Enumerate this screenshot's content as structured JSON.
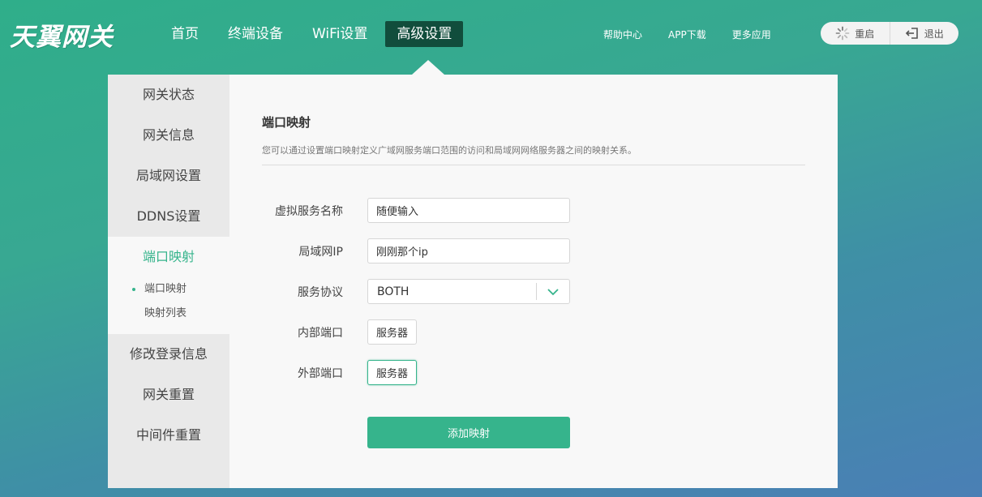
{
  "brand": {
    "logo_text": "天翼网关"
  },
  "nav": {
    "items": [
      {
        "label": "首页"
      },
      {
        "label": "终端设备"
      },
      {
        "label": "WiFi设置"
      },
      {
        "label": "高级设置",
        "active": true
      }
    ]
  },
  "top_links": [
    {
      "label": "帮助中心"
    },
    {
      "label": "APP下载"
    },
    {
      "label": "更多应用"
    }
  ],
  "actions": {
    "restart_label": "重启",
    "logout_label": "退出"
  },
  "sidebar": {
    "items_top": [
      {
        "label": "网关状态"
      },
      {
        "label": "网关信息"
      },
      {
        "label": "局域网设置"
      },
      {
        "label": "DDNS设置"
      }
    ],
    "active_group": {
      "label": "端口映射",
      "sub_items": [
        {
          "label": "端口映射",
          "active": true
        },
        {
          "label": "映射列表"
        }
      ]
    },
    "items_bottom": [
      {
        "label": "修改登录信息"
      },
      {
        "label": "网关重置"
      },
      {
        "label": "中间件重置"
      }
    ]
  },
  "content": {
    "title": "端口映射",
    "description": "您可以通过设置端口映射定义广域网服务端口范围的访问和局域网网络服务器之间的映射关系。",
    "form": {
      "service_name": {
        "label": "虚拟服务名称",
        "value": "随便输入"
      },
      "lan_ip": {
        "label": "局域网IP",
        "value": "刚刚那个ip"
      },
      "protocol": {
        "label": "服务协议",
        "value": "BOTH"
      },
      "internal_port": {
        "label": "内部端口",
        "button": "服务器"
      },
      "external_port": {
        "label": "外部端口",
        "button": "服务器"
      }
    },
    "submit_label": "添加映射"
  },
  "colors": {
    "accent": "#36b48c",
    "nav_active_bg": "#114d3c",
    "sidebar_bg": "#e9e9e9",
    "panel_bg": "#f8f8f8"
  },
  "icons": {
    "restart": "spinner-icon",
    "logout": "logout-arrow-icon",
    "select": "chevron-down-icon"
  }
}
